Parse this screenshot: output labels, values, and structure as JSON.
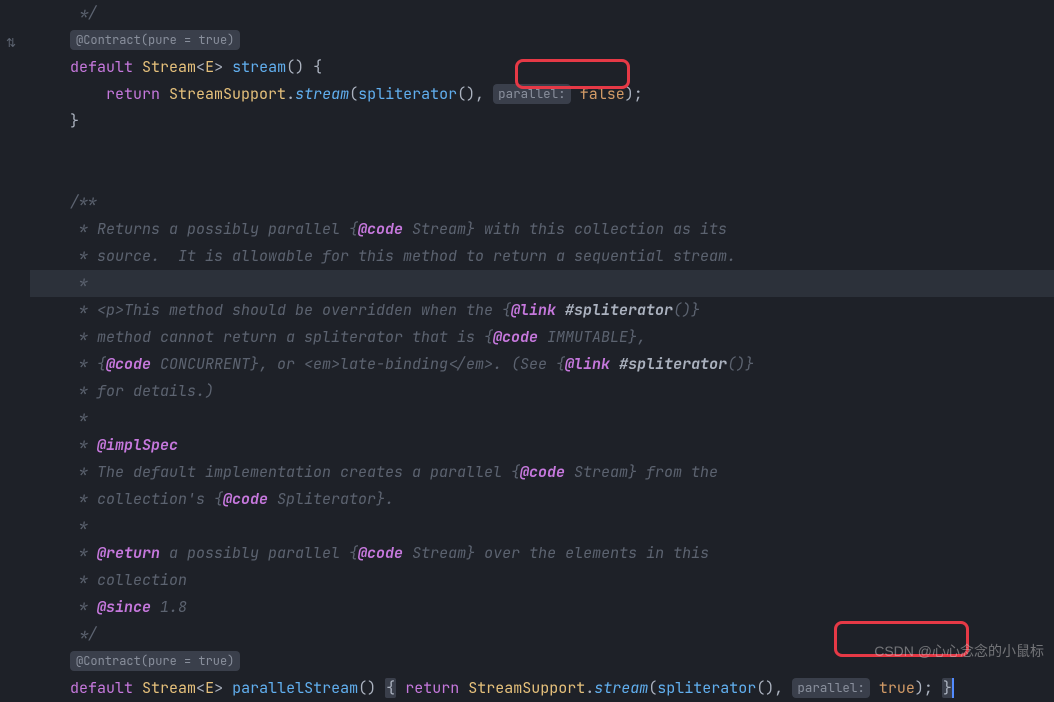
{
  "gutter": {
    "icon1_char": "⇅"
  },
  "badges": {
    "contract1": "@Contract(pure = true)",
    "contract2": "@Contract(pure = true)",
    "hint1": "parallel:",
    "hint2": "parallel:"
  },
  "code": {
    "l1_comment_close": " */",
    "l3_kw": "default",
    "l3_type": "Stream",
    "l3_lt": "<",
    "l3_generic": "E",
    "l3_gt": ">",
    "l3_method": "stream",
    "l3_parens": "()",
    "l3_brace": " {",
    "l4_kw": "return",
    "l4_cls": "StreamSupport",
    "l4_dot1": ".",
    "l4_m1": "stream",
    "l4_open": "(",
    "l4_m2": "spliterator",
    "l4_parens2": "(),",
    "l4_bool": "false",
    "l4_close": ")",
    "l4_semi": ";",
    "l5_brace": "}",
    "doc": {
      "open": "/**",
      "l1a": " * Returns a possibly parallel {",
      "l1tag": "@code",
      "l1b": " Stream} with this collection as its",
      "l2": " * source.  It is allowable for this method to return a sequential stream.",
      "lstar": " *",
      "l3a": " * <p>This method should be overridden when the {",
      "l3tag": "@link",
      "l3link": " #spliterator",
      "l3b": "()}",
      "l4a": " * method cannot return a spliterator that is {",
      "l4tag": "@code",
      "l4b": " IMMUTABLE},",
      "l5a": " * {",
      "l5tag1": "@code",
      "l5b": " CONCURRENT}, or <em>late-binding</em>. (See {",
      "l5tag2": "@link",
      "l5link": " #spliterator",
      "l5c": "()}",
      "l6": " * for details.)",
      "l8tag": "@implSpec",
      "l9a": " * The default implementation creates a parallel {",
      "l9tag": "@code",
      "l9b": " Stream} from the",
      "l10a": " * collection's {",
      "l10tag": "@code",
      "l10b": " Spliterator}.",
      "l12a": " * ",
      "l12tag": "@return",
      "l12b": " a possibly parallel {",
      "l12tag2": "@code",
      "l12c": " Stream} over the elements in this",
      "l13": " * collection",
      "l14a": " * ",
      "l14tag": "@since",
      "l14b": " 1.8",
      "close": " */"
    },
    "p_kw": "default",
    "p_type": "Stream",
    "p_lt": "<",
    "p_generic": "E",
    "p_gt": ">",
    "p_method": "parallelStream",
    "p_parens": "()",
    "p_brace_open": "{",
    "p_ret": "return",
    "p_cls": "StreamSupport",
    "p_dot": ".",
    "p_m1": "stream",
    "p_open": "(",
    "p_m2": "spliterator",
    "p_parens2": "(),",
    "p_bool": "true",
    "p_close": ")",
    "p_semi": ";",
    "p_brace_close": "}"
  },
  "watermark": "CSDN @心心念念的小鼠标"
}
